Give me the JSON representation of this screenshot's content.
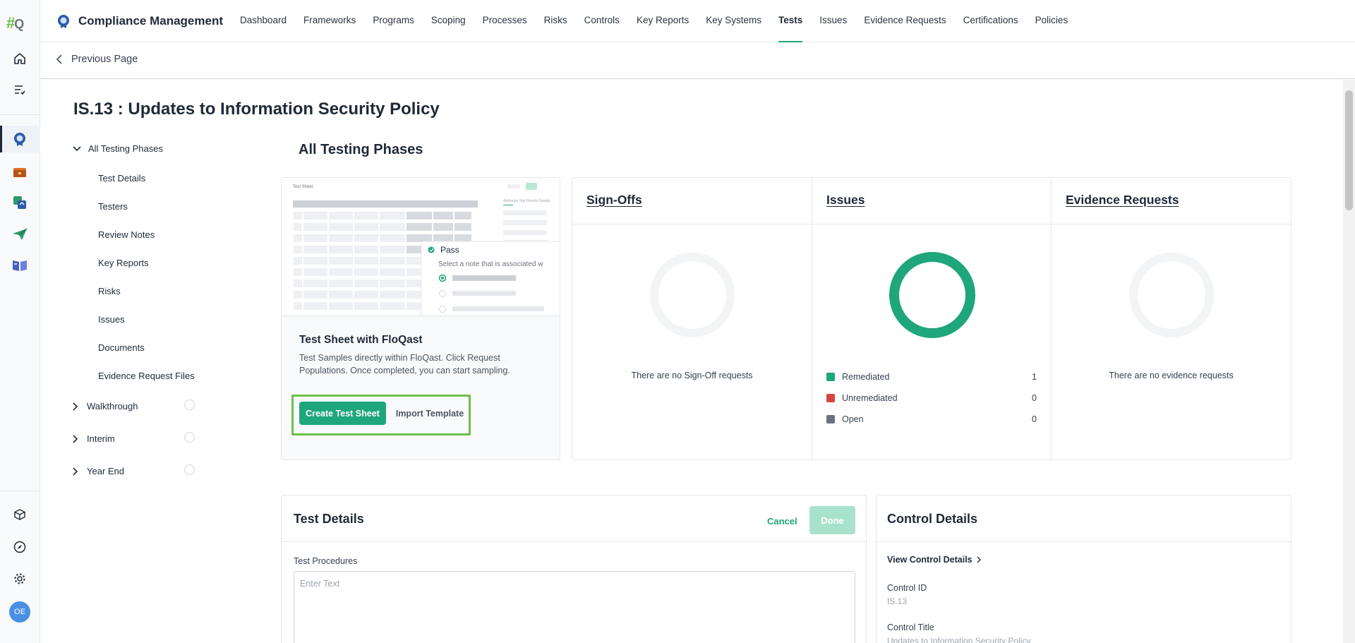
{
  "app": {
    "logo_hash": "#",
    "logo_q": "Q",
    "title": "Compliance Management",
    "user_initials": "OE"
  },
  "rail": {
    "items": [
      "home-icon",
      "tasks-icon",
      "compliance-icon",
      "folder-icon",
      "sync-icon",
      "send-icon",
      "book-icon"
    ],
    "bottom_items": [
      "cube-icon",
      "compass-icon",
      "gear-icon"
    ]
  },
  "nav": {
    "items": [
      "Dashboard",
      "Frameworks",
      "Programs",
      "Scoping",
      "Processes",
      "Risks",
      "Controls",
      "Key Reports",
      "Key Systems",
      "Tests",
      "Issues",
      "Evidence Requests",
      "Certifications",
      "Policies"
    ],
    "active": "Tests"
  },
  "subbar": {
    "back_label": "Previous Page"
  },
  "page": {
    "title": "IS.13 : Updates to Information Security Policy"
  },
  "tree": {
    "root_label": "All Testing Phases",
    "children": [
      "Test Details",
      "Testers",
      "Review Notes",
      "Key Reports",
      "Risks",
      "Issues",
      "Documents",
      "Evidence Request Files"
    ],
    "phases": [
      "Walkthrough",
      "Interim",
      "Year End"
    ]
  },
  "main": {
    "section_title": "All Testing Phases",
    "test_sheet": {
      "preview_title": "Test Sheet",
      "preview_tabs": "Attributes   Test Results   Details",
      "popup_title": "Pass",
      "popup_desc": "Select a note that is associated w",
      "heading": "Test Sheet with FloQast",
      "description": "Test Samples directly within FloQast. Click Request Populations. Once completed, you can start sampling.",
      "create_label": "Create Test Sheet",
      "import_label": "Import Template"
    },
    "sign_offs": {
      "title": "Sign-Offs",
      "empty": "There are no Sign-Off requests"
    },
    "issues": {
      "title": "Issues",
      "legend": [
        {
          "label": "Remediated",
          "count": "1",
          "color": "#1fa67a"
        },
        {
          "label": "Unremediated",
          "count": "0",
          "color": "#d64545"
        },
        {
          "label": "Open",
          "count": "0",
          "color": "#6b7280"
        }
      ]
    },
    "evidence_requests": {
      "title": "Evidence Requests",
      "empty": "There are no evidence requests"
    }
  },
  "test_details": {
    "title": "Test Details",
    "cancel_label": "Cancel",
    "done_label": "Done",
    "procedures_label": "Test Procedures",
    "procedures_placeholder": "Enter Text",
    "procedures_value": ""
  },
  "control_details": {
    "title": "Control Details",
    "view_link": "View Control Details",
    "id_label": "Control ID",
    "id_value": "IS.13",
    "title_label": "Control Title",
    "title_value": "Updates to Information Security Policy"
  },
  "colors": {
    "accent": "#1fa67a",
    "highlight": "#6cc04a",
    "done_disabled": "#a9e2cc"
  }
}
